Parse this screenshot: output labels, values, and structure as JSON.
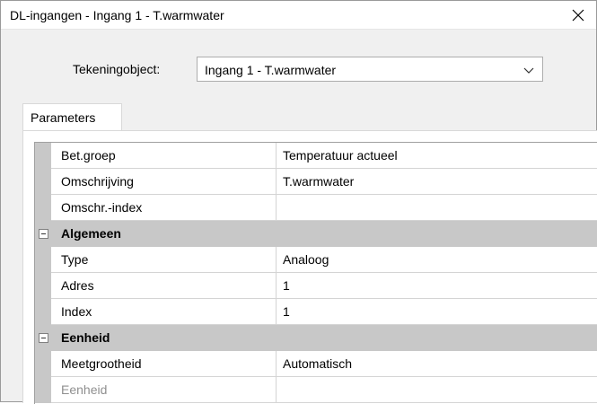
{
  "window": {
    "title": "DL-ingangen - Ingang 1 - T.warmwater"
  },
  "selector": {
    "label": "Tekeningobject:",
    "value": "Ingang 1 - T.warmwater"
  },
  "tabs": [
    {
      "label": "Parameters"
    }
  ],
  "properties": {
    "rows": [
      {
        "name": "Bet.groep",
        "value": "Temperatuur actueel"
      },
      {
        "name": "Omschrijving",
        "value": "T.warmwater"
      },
      {
        "name": "Omschr.-index",
        "value": ""
      }
    ],
    "categories": [
      {
        "label": "Algemeen",
        "rows": [
          {
            "name": "Type",
            "value": "Analoog"
          },
          {
            "name": "Adres",
            "value": "1"
          },
          {
            "name": "Index",
            "value": "1"
          }
        ]
      },
      {
        "label": "Eenheid",
        "rows": [
          {
            "name": "Meetgrootheid",
            "value": "Automatisch"
          },
          {
            "name": "Eenheid",
            "value": ""
          }
        ]
      }
    ]
  },
  "icons": {
    "close": "close-icon",
    "dropdown": "chevron-down-icon",
    "collapse": "collapse-icon"
  }
}
